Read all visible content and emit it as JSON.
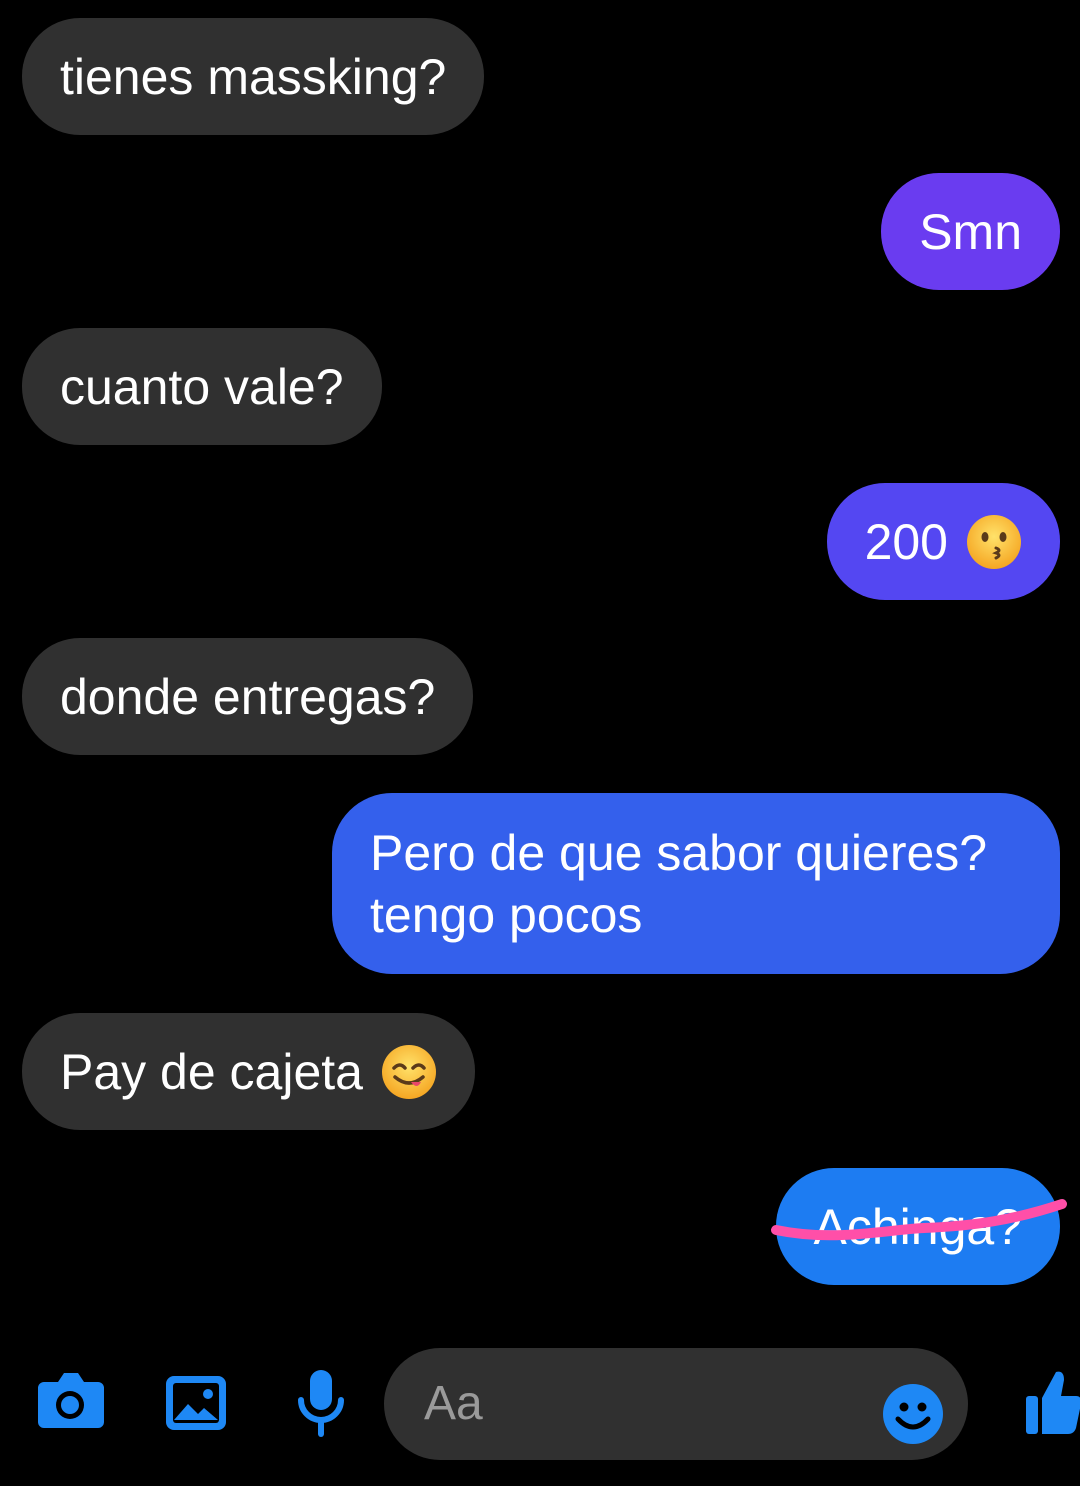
{
  "messages": [
    {
      "id": "m1",
      "direction": "incoming",
      "text": "tienes massking?"
    },
    {
      "id": "m2",
      "direction": "outgoing",
      "text": "Smn",
      "color": "#6a3cf0"
    },
    {
      "id": "m3",
      "direction": "incoming",
      "text": "cuanto vale?"
    },
    {
      "id": "m4",
      "direction": "outgoing",
      "text": "200",
      "emoji": "kissing-face-emoji",
      "color": "#5447f2"
    },
    {
      "id": "m5",
      "direction": "incoming",
      "text": "donde entregas?"
    },
    {
      "id": "m6",
      "direction": "outgoing",
      "lines": [
        "Pero de que sabor quieres?",
        "tengo pocos"
      ],
      "color": "#3460ec"
    },
    {
      "id": "m7",
      "direction": "incoming",
      "text": "Pay de cajeta",
      "emoji": "yum-face-emoji"
    },
    {
      "id": "m8",
      "direction": "outgoing",
      "text": "Achinga?",
      "struck_through": true,
      "strike_color": "#ff4fa8",
      "color": "#1d7cf2"
    }
  ],
  "composer": {
    "placeholder": "Aa",
    "icons": [
      "camera-icon",
      "gallery-icon",
      "microphone-icon",
      "emoji-icon",
      "like-icon"
    ],
    "accent": "#1e88f5"
  },
  "colors": {
    "background": "#000000",
    "incoming_bubble": "#303030"
  }
}
